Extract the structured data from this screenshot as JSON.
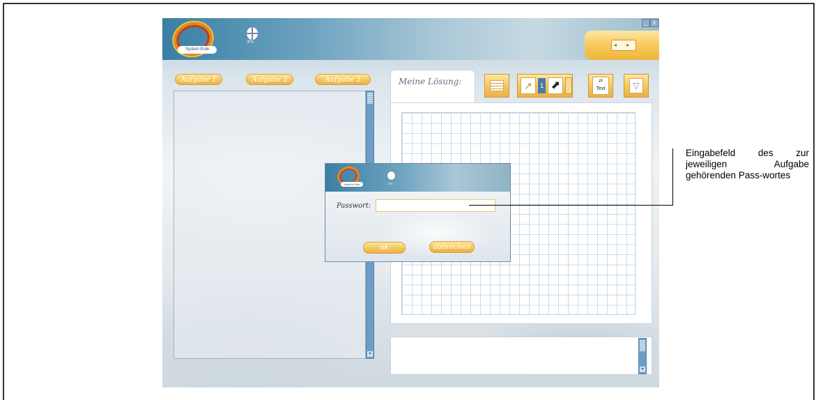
{
  "app": {
    "logo_text": "System Erde",
    "ipn_label": "IPN",
    "window_controls": [
      "_",
      "x"
    ],
    "nav_arrows": "◂ ▸"
  },
  "tasks": {
    "tabs": [
      {
        "label": "Aufgabe 1"
      },
      {
        "label": "Aufgabe 2"
      },
      {
        "label": "Aufgabe 3"
      }
    ]
  },
  "solution": {
    "tab_label": "Meine Lösung:",
    "toolbar": [
      {
        "icon": "list-icon"
      },
      {
        "icon": "arrow-tools-icon",
        "value": "1"
      },
      {
        "icon": "text-tool-icon",
        "label": "Text"
      },
      {
        "icon": "trash-icon"
      }
    ]
  },
  "dialog": {
    "logo_text": "System Erde",
    "ipn_label": "IPN",
    "password_label": "Passwort:",
    "password_value": "",
    "ok_label": "ok",
    "cancel_label": "abbrechen"
  },
  "annotation": {
    "text": "Eingabefeld des zur jeweiligen Aufgabe gehörenden Pass-wortes"
  },
  "colors": {
    "accent_orange": "#f6c65a",
    "header_blue": "#3a7fa3",
    "scrollbar_blue": "#6e9ec7"
  }
}
